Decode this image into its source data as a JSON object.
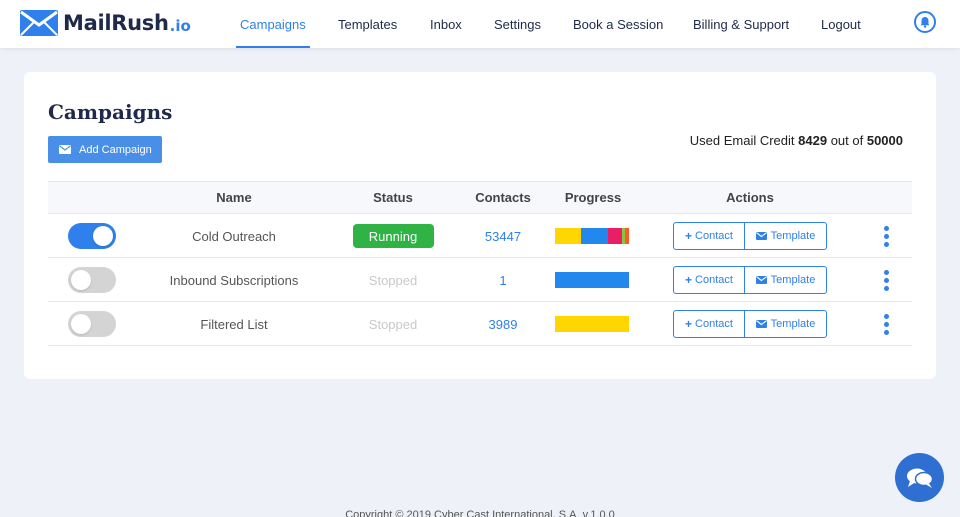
{
  "brand": {
    "name": "MailRush",
    "ext": ".io"
  },
  "nav": {
    "items": [
      "Campaigns",
      "Templates",
      "Inbox",
      "Settings",
      "Book a Session",
      "Billing & Support",
      "Logout"
    ],
    "active": "Campaigns"
  },
  "page": {
    "title": "Campaigns",
    "add_label": "Add Campaign",
    "credit": {
      "prefix": "Used Email Credit",
      "used": "8429",
      "middle": "out of",
      "total": "50000"
    }
  },
  "table": {
    "headers": {
      "name": "Name",
      "status": "Status",
      "contacts": "Contacts",
      "progress": "Progress",
      "actions": "Actions"
    },
    "rows": [
      {
        "enabled": true,
        "name": "Cold Outreach",
        "status": "Running",
        "contacts": "53447",
        "progress": [
          {
            "color": "#ffd600",
            "share": 0.35
          },
          {
            "color": "#2288ee",
            "share": 0.36
          },
          {
            "color": "#e91e63",
            "share": 0.19
          },
          {
            "color": "#8bc34a",
            "share": 0.05
          },
          {
            "color": "#ff5a1f",
            "share": 0.05
          }
        ]
      },
      {
        "enabled": false,
        "name": "Inbound Subscriptions",
        "status": "Stopped",
        "contacts": "1",
        "progress": [
          {
            "color": "#2288ee",
            "share": 1.0
          }
        ]
      },
      {
        "enabled": false,
        "name": "Filtered List",
        "status": "Stopped",
        "contacts": "3989",
        "progress": [
          {
            "color": "#ffd600",
            "share": 1.0
          }
        ]
      }
    ],
    "action_contact": "Contact",
    "action_template": "Template"
  },
  "footer": {
    "text": "Copyright © 2019 Cyber Cast International, S.A. v.1.0.0"
  },
  "colors": {
    "accent": "#2f80ed",
    "running": "#2fb344",
    "stopped": "#c9c9c9",
    "brand_dark": "#1f2a4a"
  },
  "icons": {
    "logo": "envelope-icon",
    "bell": "bell-icon",
    "add": "envelope-icon",
    "contact": "plus-icon",
    "template": "envelope-icon",
    "menu": "kebab-menu-icon",
    "chat": "chat-icon"
  }
}
